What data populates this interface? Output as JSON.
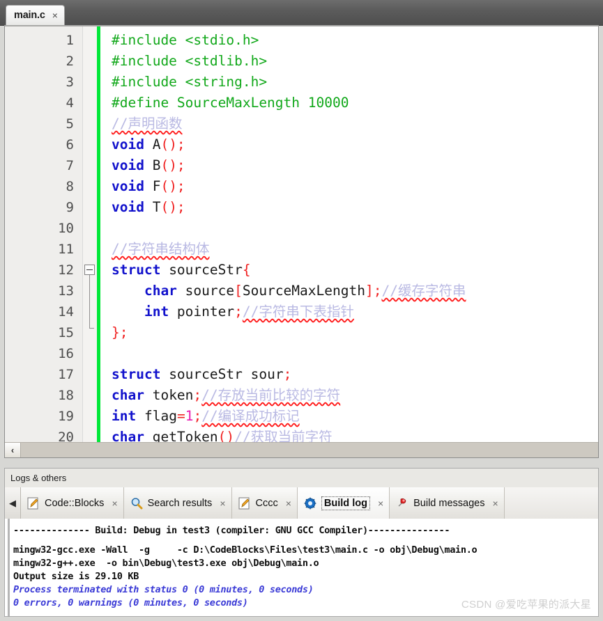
{
  "editor": {
    "tab": {
      "label": "main.c",
      "close": "×"
    },
    "lines": [
      {
        "num": "1",
        "tokens": [
          {
            "t": "pre",
            "s": "#include <stdio.h>"
          }
        ]
      },
      {
        "num": "2",
        "tokens": [
          {
            "t": "pre",
            "s": "#include <stdlib.h>"
          }
        ]
      },
      {
        "num": "3",
        "tokens": [
          {
            "t": "pre",
            "s": "#include <string.h>"
          }
        ]
      },
      {
        "num": "4",
        "tokens": [
          {
            "t": "pre",
            "s": "#define SourceMaxLength 10000"
          }
        ]
      },
      {
        "num": "5",
        "tokens": [
          {
            "t": "cmt-sq",
            "s": "//声明函数"
          }
        ]
      },
      {
        "num": "6",
        "tokens": [
          {
            "t": "kw",
            "s": "void"
          },
          {
            "t": "id",
            "s": " A"
          },
          {
            "t": "punc",
            "s": "();"
          }
        ]
      },
      {
        "num": "7",
        "tokens": [
          {
            "t": "kw",
            "s": "void"
          },
          {
            "t": "id",
            "s": " B"
          },
          {
            "t": "punc",
            "s": "();"
          }
        ]
      },
      {
        "num": "8",
        "tokens": [
          {
            "t": "kw",
            "s": "void"
          },
          {
            "t": "id",
            "s": " F"
          },
          {
            "t": "punc",
            "s": "();"
          }
        ]
      },
      {
        "num": "9",
        "tokens": [
          {
            "t": "kw",
            "s": "void"
          },
          {
            "t": "id",
            "s": " T"
          },
          {
            "t": "punc",
            "s": "();"
          }
        ]
      },
      {
        "num": "10",
        "tokens": []
      },
      {
        "num": "11",
        "tokens": [
          {
            "t": "cmt-sq",
            "s": "//字符串结构体"
          }
        ]
      },
      {
        "num": "12",
        "tokens": [
          {
            "t": "kw",
            "s": "struct"
          },
          {
            "t": "id",
            "s": " sourceStr"
          },
          {
            "t": "punc",
            "s": "{"
          }
        ]
      },
      {
        "num": "13",
        "tokens": [
          {
            "t": "kw",
            "s": "    char"
          },
          {
            "t": "id",
            "s": " source"
          },
          {
            "t": "punc",
            "s": "["
          },
          {
            "t": "id",
            "s": "SourceMaxLength"
          },
          {
            "t": "punc",
            "s": "];"
          },
          {
            "t": "cmt-sq",
            "s": "//缓存字符串"
          }
        ]
      },
      {
        "num": "14",
        "tokens": [
          {
            "t": "kw",
            "s": "    int"
          },
          {
            "t": "id",
            "s": " pointer"
          },
          {
            "t": "punc",
            "s": ";"
          },
          {
            "t": "cmt-sq",
            "s": "//字符串下表指针"
          }
        ]
      },
      {
        "num": "15",
        "tokens": [
          {
            "t": "punc",
            "s": "};"
          }
        ]
      },
      {
        "num": "16",
        "tokens": []
      },
      {
        "num": "17",
        "tokens": [
          {
            "t": "kw",
            "s": "struct"
          },
          {
            "t": "id",
            "s": " sourceStr sour"
          },
          {
            "t": "punc",
            "s": ";"
          }
        ]
      },
      {
        "num": "18",
        "tokens": [
          {
            "t": "kw",
            "s": "char"
          },
          {
            "t": "id",
            "s": " token"
          },
          {
            "t": "punc",
            "s": ";"
          },
          {
            "t": "cmt-sq",
            "s": "//存放当前比较的字符"
          }
        ]
      },
      {
        "num": "19",
        "tokens": [
          {
            "t": "kw",
            "s": "int"
          },
          {
            "t": "id",
            "s": " flag"
          },
          {
            "t": "punc",
            "s": "="
          },
          {
            "t": "num",
            "s": "1"
          },
          {
            "t": "punc",
            "s": ";"
          },
          {
            "t": "cmt-sq",
            "s": "//编译成功标记"
          }
        ]
      },
      {
        "num": "20",
        "tokens": [
          {
            "t": "kw",
            "s": "char"
          },
          {
            "t": "id",
            "s": " getToken"
          },
          {
            "t": "punc",
            "s": "()"
          },
          {
            "t": "cmt-sq",
            "s": "//获取当前字符"
          }
        ]
      }
    ],
    "scroll_left_arrow": "‹"
  },
  "logs_panel": {
    "caption": "Logs & others",
    "scroll_left_arrow": "◀",
    "tabs": [
      {
        "label": "Code::Blocks",
        "icon": "pencil-icon",
        "close": "×",
        "active": false
      },
      {
        "label": "Search results",
        "icon": "magnifier-icon",
        "close": "×",
        "active": false
      },
      {
        "label": "Cccc",
        "icon": "pencil-icon",
        "close": "×",
        "active": false
      },
      {
        "label": "Build log",
        "icon": "gear-icon",
        "close": "×",
        "active": true
      },
      {
        "label": "Build messages",
        "icon": "pin-icon",
        "close": "×",
        "active": false
      }
    ],
    "log_lines": [
      {
        "text": "-------------- Build: Debug in test3 (compiler: GNU GCC Compiler)---------------",
        "style": "normal"
      },
      {
        "text": "",
        "style": "spacer"
      },
      {
        "text": "mingw32-gcc.exe -Wall  -g     -c D:\\CodeBlocks\\Files\\test3\\main.c -o obj\\Debug\\main.o",
        "style": "normal"
      },
      {
        "text": "mingw32-g++.exe  -o bin\\Debug\\test3.exe obj\\Debug\\main.o",
        "style": "normal"
      },
      {
        "text": "Output size is 29.10 KB",
        "style": "normal"
      },
      {
        "text": "Process terminated with status 0 (0 minutes, 0 seconds)",
        "style": "blue"
      },
      {
        "text": "0 errors, 0 warnings (0 minutes, 0 seconds)",
        "style": "blue"
      }
    ]
  },
  "watermark": "CSDN @爱吃苹果的派大星",
  "colors": {
    "preprocessor": "#11a81a",
    "keyword": "#1111cc",
    "punctuation": "#f02020",
    "number": "#e81ab0",
    "comment": "#b9b9e3",
    "change_bar": "#00e838",
    "log_blue": "#3a3ad6"
  }
}
